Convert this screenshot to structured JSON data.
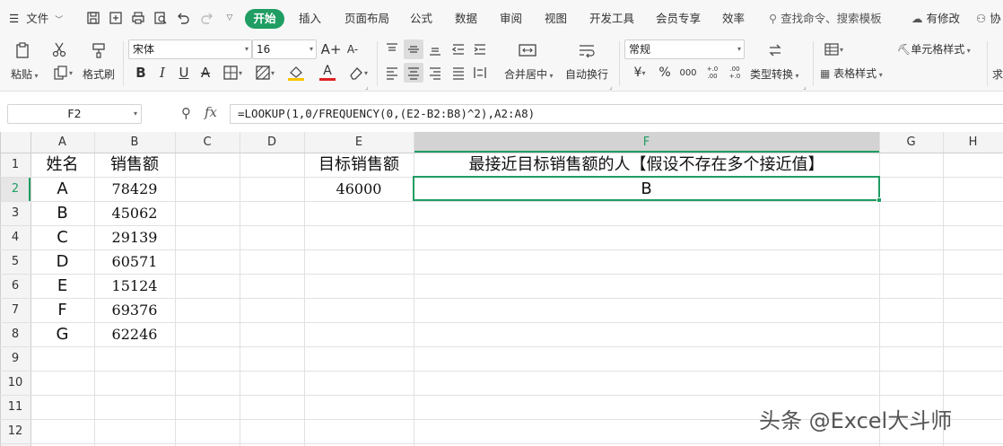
{
  "menubar": {
    "hamburger": "☰",
    "file": "文件",
    "start_tab": "开始",
    "tabs": [
      "插入",
      "页面布局",
      "公式",
      "数据",
      "审阅",
      "视图",
      "开发工具",
      "会员专享",
      "效率"
    ],
    "search": "查找命令、搜索模板",
    "changes": "有修改",
    "collab": "协"
  },
  "ribbon": {
    "paste": "粘贴",
    "format_painter": "格式刷",
    "font_name": "宋体",
    "font_size": "16",
    "grow_font": "A+",
    "shrink_font": "A-",
    "bold": "B",
    "italic": "I",
    "underline": "U",
    "strike": "A",
    "fill_label": "A",
    "merge_center": "合并居中",
    "wrap_text": "自动换行",
    "number_format": "常规",
    "currency": "¥",
    "percent": "%",
    "thousands": "000",
    "inc_decimal": "+.0 .00",
    "dec_decimal": ".00 +.0",
    "type_convert": "类型转换",
    "cell_style": "单元格样式",
    "table_style": "表格样式",
    "sum_cut": "求",
    "font_color": "#e02020",
    "fill_color": "#f5c400"
  },
  "formula_bar": {
    "name_box": "F2",
    "fx": "fx",
    "formula": "=LOOKUP(1,0/FREQUENCY(0,(E2-B2:B8)^2),A2:A8)"
  },
  "columns": [
    "A",
    "B",
    "C",
    "D",
    "E",
    "F",
    "G",
    "H"
  ],
  "rows": [
    "1",
    "2",
    "3",
    "4",
    "5",
    "6",
    "7",
    "8",
    "9",
    "10",
    "11",
    "12"
  ],
  "sheet": {
    "header_a": "姓名",
    "header_b": "销售额",
    "names": [
      "A",
      "B",
      "C",
      "D",
      "E",
      "F",
      "G"
    ],
    "sales": [
      "78429",
      "45062",
      "29139",
      "60571",
      "15124",
      "69376",
      "62246"
    ],
    "target_label": "目标销售额",
    "target_value": "46000",
    "result_label": "最接近目标销售额的人【假设不存在多个接近值】",
    "result_value": "B"
  },
  "watermark": "头条 @Excel大斗师",
  "colors": {
    "accent": "#1f9d63",
    "selected_header": "#d3d3d3"
  }
}
